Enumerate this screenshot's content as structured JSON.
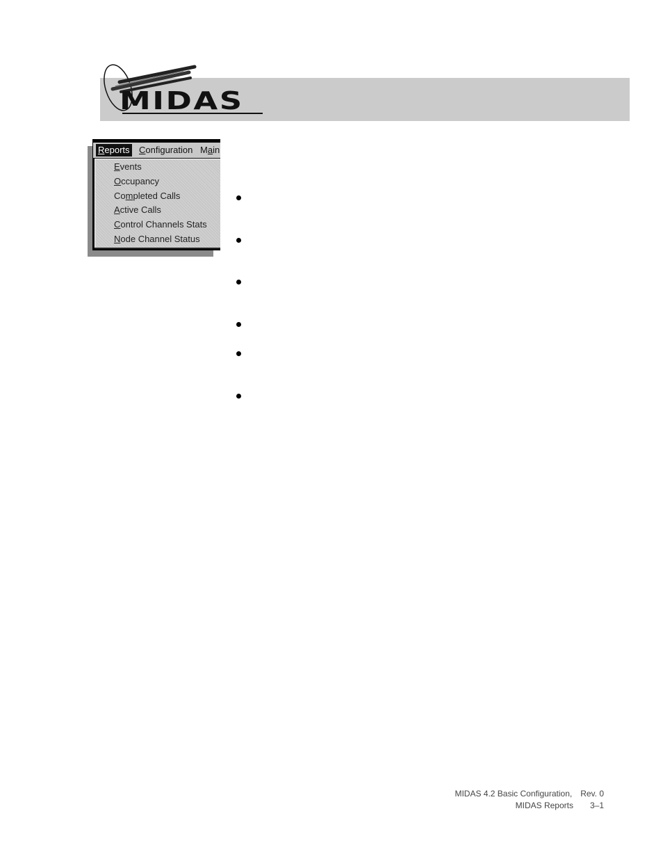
{
  "header": {
    "logo_text": "MIDAS",
    "bar_color": "#cbcbcb"
  },
  "menu": {
    "menubar": [
      {
        "label": "Reports",
        "mnemonic": "R",
        "active": true
      },
      {
        "label": "Configuration",
        "mnemonic": "C",
        "active": false
      },
      {
        "label": "Main",
        "mnemonic": "a",
        "active": false
      }
    ],
    "items": [
      {
        "pre": "",
        "key": "E",
        "post": "vents",
        "label": "Events"
      },
      {
        "pre": "",
        "key": "O",
        "post": "ccupancy",
        "label": "Occupancy"
      },
      {
        "pre": "Co",
        "key": "m",
        "post": "pleted Calls",
        "label": "Completed Calls"
      },
      {
        "pre": "",
        "key": "A",
        "post": "ctive Calls",
        "label": "Active Calls"
      },
      {
        "pre": "",
        "key": "C",
        "post": "ontrol Channels Stats",
        "label": "Control Channels Stats"
      },
      {
        "pre": "",
        "key": "N",
        "post": "ode Channel Status",
        "label": "Node Channel Status"
      }
    ]
  },
  "bullets": {
    "count": 6
  },
  "footer": {
    "doc_title": "MIDAS 4.2 Basic Configuration,",
    "revision": "Rev. 0",
    "section": "MIDAS Reports",
    "page": "3–1"
  }
}
